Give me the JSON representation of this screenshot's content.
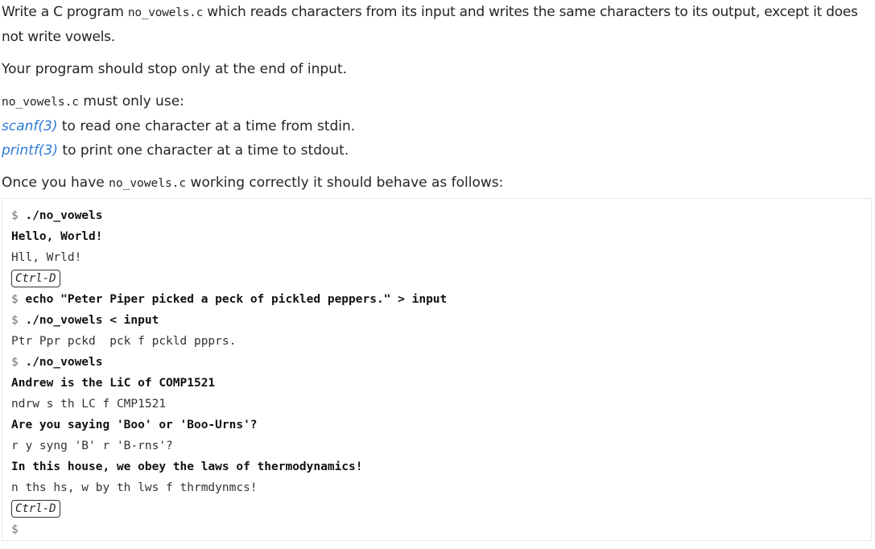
{
  "intro": {
    "p1_before": "Write a C program ",
    "p1_code": "no_vowels.c",
    "p1_after": " which reads characters from its input and writes the same characters to its output, except it does not write vowels.",
    "p2": "Your program should stop only at the end of input.",
    "p3_code": "no_vowels.c",
    "p3_after": " must only use:",
    "scanf_link": "scanf(3)",
    "scanf_text": " to read one character at a time from stdin.",
    "printf_link": "printf(3)",
    "printf_text": " to print one character at a time to stdout.",
    "p4_before": "Once you have ",
    "p4_code": "no_vowels.c",
    "p4_after": " working correctly it should behave as follows:"
  },
  "terminal": {
    "prompt": "$",
    "lines": [
      {
        "type": "command",
        "text": "./no_vowels"
      },
      {
        "type": "input",
        "text": "Hello, World!"
      },
      {
        "type": "output",
        "text": "Hll, Wrld!"
      },
      {
        "type": "key",
        "text": "Ctrl-D"
      },
      {
        "type": "command",
        "text": "echo \"Peter Piper picked a peck of pickled peppers.\" > input"
      },
      {
        "type": "command",
        "text": "./no_vowels < input"
      },
      {
        "type": "output",
        "text": "Ptr Ppr pckd  pck f pckld pppRS."
      },
      {
        "type": "command",
        "text": "./no_vowels"
      },
      {
        "type": "input",
        "text": "Andrew is the LiC of COMP1521"
      },
      {
        "type": "output",
        "text": "ndrw s th LC f CMP1521"
      },
      {
        "type": "input",
        "text": "Are you saying 'Boo' or 'Boo-Urns'?"
      },
      {
        "type": "output",
        "text": "r y syng 'B' r 'B-rns'?"
      },
      {
        "type": "input",
        "text": "In this house, we obey the laws of thermodynamics!"
      },
      {
        "type": "output",
        "text": "n ths hs, w by th lws f thrmdynmcs!"
      },
      {
        "type": "key",
        "text": "Ctrl-D"
      },
      {
        "type": "prompt-only",
        "text": ""
      }
    ]
  }
}
